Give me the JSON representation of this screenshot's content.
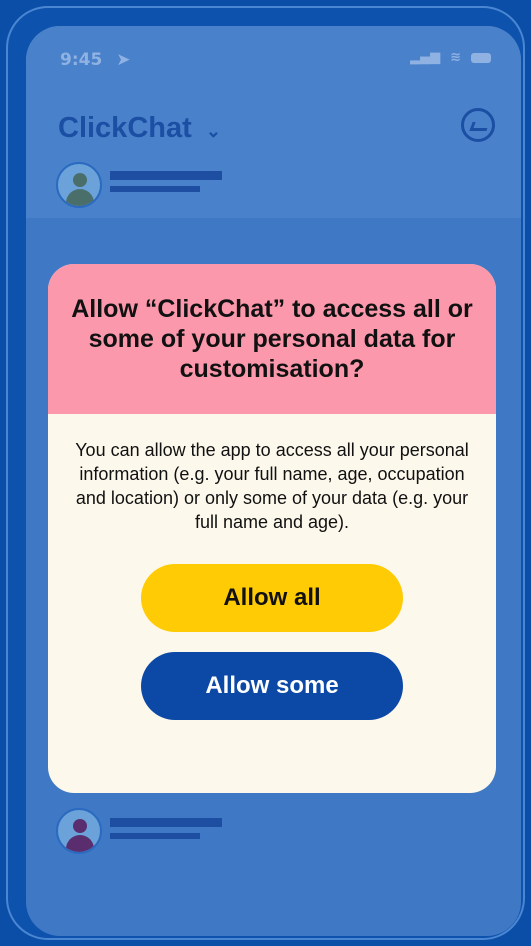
{
  "status": {
    "time": "9:45"
  },
  "header": {
    "app_name": "ClickChat"
  },
  "dialog": {
    "title": "Allow “ClickChat” to access all or some of your personal data for customisation?",
    "body": "You can allow the app to access all your personal information (e.g. your full name, age, occupation and location) or only some of your data (e.g. your full name and age).",
    "allow_all_label": "Allow all",
    "allow_some_label": "Allow some"
  },
  "colors": {
    "accent_yellow": "#ffcb05",
    "accent_blue": "#0c49a6",
    "dialog_header": "#fc98ac"
  }
}
